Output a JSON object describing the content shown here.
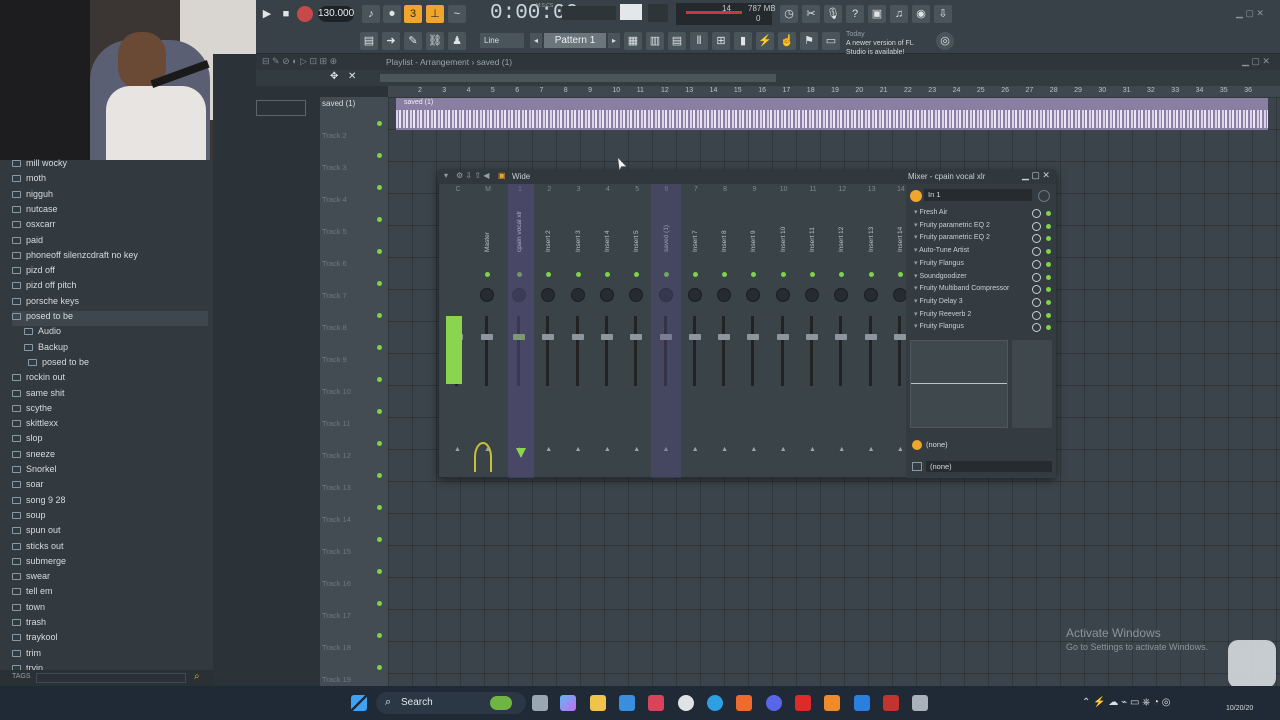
{
  "app": {
    "name": "FL Studio",
    "playlist_title": "Playlist - Arrangement › saved (1)",
    "update_note_day": "Today",
    "update_note": "A newer version of FL Studio is available!"
  },
  "transport": {
    "tempo": "130.000",
    "time": "0:00:00",
    "time_unit": "M:S:CS",
    "memory": "787 MB",
    "cpu": "14",
    "poly": "0",
    "snap_mode": "Line",
    "pattern": "Pattern 1"
  },
  "browser": {
    "items": [
      {
        "label": "mill wocky",
        "type": "folder"
      },
      {
        "label": "moth",
        "type": "folder"
      },
      {
        "label": "nigguh",
        "type": "folder"
      },
      {
        "label": "nutcase",
        "type": "folder"
      },
      {
        "label": "osxcarr",
        "type": "folder"
      },
      {
        "label": "paid",
        "type": "folder"
      },
      {
        "label": "phoneoff silenzcdraft no key",
        "type": "folder"
      },
      {
        "label": "pizd off",
        "type": "folder"
      },
      {
        "label": "pizd off pitch",
        "type": "folder"
      },
      {
        "label": "porsche keys",
        "type": "folder"
      },
      {
        "label": "posed to be",
        "type": "folder-open"
      },
      {
        "label": "Audio",
        "type": "subfolder"
      },
      {
        "label": "Backup",
        "type": "subfolder"
      },
      {
        "label": "posed to be",
        "type": "file"
      },
      {
        "label": "rockin out",
        "type": "folder"
      },
      {
        "label": "same shit",
        "type": "folder"
      },
      {
        "label": "scythe",
        "type": "folder"
      },
      {
        "label": "skittlexx",
        "type": "folder"
      },
      {
        "label": "slop",
        "type": "folder"
      },
      {
        "label": "sneeze",
        "type": "folder"
      },
      {
        "label": "Snorkel",
        "type": "folder"
      },
      {
        "label": "soar",
        "type": "folder"
      },
      {
        "label": "song 9 28",
        "type": "folder"
      },
      {
        "label": "soup",
        "type": "folder"
      },
      {
        "label": "spun out",
        "type": "folder"
      },
      {
        "label": "sticks out",
        "type": "folder"
      },
      {
        "label": "submerge",
        "type": "folder"
      },
      {
        "label": "swear",
        "type": "folder"
      },
      {
        "label": "tell em",
        "type": "folder"
      },
      {
        "label": "town",
        "type": "folder"
      },
      {
        "label": "trash",
        "type": "folder"
      },
      {
        "label": "traykool",
        "type": "folder"
      },
      {
        "label": "trim",
        "type": "folder"
      },
      {
        "label": "tryin",
        "type": "folder"
      }
    ],
    "tags_label": "TAGS"
  },
  "playlist": {
    "clip_name": "saved (1)",
    "ruler": [
      "2",
      "3",
      "4",
      "5",
      "6",
      "7",
      "8",
      "9",
      "10",
      "11",
      "12",
      "13",
      "14",
      "15",
      "16",
      "17",
      "18",
      "19",
      "20",
      "21",
      "22",
      "23",
      "24",
      "25",
      "26",
      "27",
      "28",
      "29",
      "30",
      "31",
      "32",
      "33",
      "34",
      "35",
      "36"
    ],
    "tracks": [
      "saved (1)",
      "Track 2",
      "Track 3",
      "Track 4",
      "Track 5",
      "Track 6",
      "Track 7",
      "Track 8",
      "Track 9",
      "Track 10",
      "Track 11",
      "Track 12",
      "Track 13",
      "Track 14",
      "Track 15",
      "Track 16",
      "Track 17",
      "Track 18",
      "Track 19"
    ]
  },
  "mixer": {
    "title": "Mixer - cpain vocal xlr",
    "view_mode": "Wide",
    "input": "In 1",
    "output_top": "(none)",
    "output_bottom": "(none)",
    "strips": [
      {
        "num": "C",
        "label": ""
      },
      {
        "num": "M",
        "label": "Master"
      },
      {
        "num": "1",
        "label": "cpain vocal xlr"
      },
      {
        "num": "2",
        "label": "Insert 2"
      },
      {
        "num": "3",
        "label": "Insert 3"
      },
      {
        "num": "4",
        "label": "Insert 4"
      },
      {
        "num": "5",
        "label": "Insert 5"
      },
      {
        "num": "6",
        "label": "saved (1)"
      },
      {
        "num": "7",
        "label": "Insert 7"
      },
      {
        "num": "8",
        "label": "Insert 8"
      },
      {
        "num": "9",
        "label": "Insert 9"
      },
      {
        "num": "10",
        "label": "Insert 10"
      },
      {
        "num": "11",
        "label": "Insert 11"
      },
      {
        "num": "12",
        "label": "Insert 12"
      },
      {
        "num": "13",
        "label": "Insert 13"
      },
      {
        "num": "14",
        "label": "Insert 14"
      }
    ],
    "effects": [
      "Fresh Air",
      "Fruity parametric EQ 2",
      "Fruity parametric EQ 2",
      "Auto-Tune Artist",
      "Fruity Flangus",
      "Soundgoodizer",
      "Fruity Multiband Compressor",
      "Fruity Delay 3",
      "Fruity Reeverb 2",
      "Fruity Flangus"
    ]
  },
  "taskbar": {
    "search": "Search",
    "date": "10/20/20"
  },
  "watermark": {
    "line1": "Activate Windows",
    "line2": "Go to Settings to activate Windows."
  }
}
